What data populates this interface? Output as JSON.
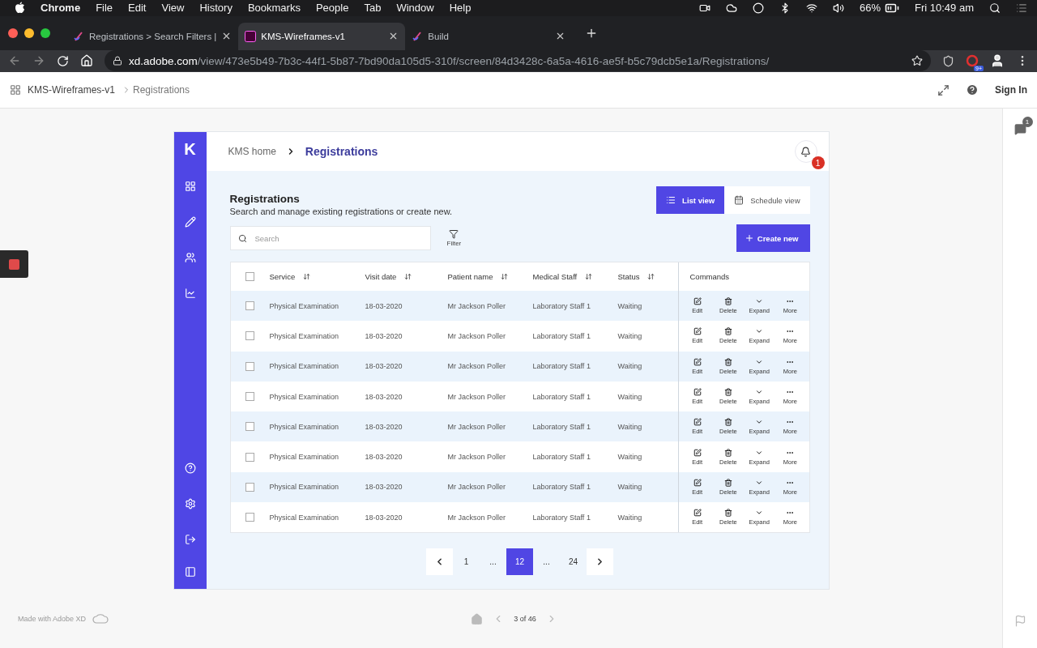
{
  "menubar": {
    "app": "Chrome",
    "items": [
      "File",
      "Edit",
      "View",
      "History",
      "Bookmarks",
      "People",
      "Tab",
      "Window",
      "Help"
    ],
    "battery": "66%",
    "clock": "Fri 10:49 am"
  },
  "browser": {
    "tabs": [
      {
        "title": "Registrations > Search Filters |",
        "kind": "build",
        "selected": false
      },
      {
        "title": "KMS-Wireframes-v1",
        "kind": "xd",
        "selected": true
      },
      {
        "title": "Build",
        "kind": "build",
        "selected": false
      }
    ],
    "url_host": "xd.adobe.com",
    "url_path": "/view/473e5b49-7b3c-44f1-5b87-7bd90da105d5-310f/screen/84d3428c-6a5a-4616-ae5f-b5c79dcb5e1a/Registrations/",
    "extension_badge": "9+"
  },
  "xd_bar": {
    "project": "KMS-Wireframes-v1",
    "screen": "Registrations",
    "sign_in": "Sign In",
    "comment_count": "1"
  },
  "app": {
    "logo": "K",
    "nav_top": [
      {
        "kind": "grid"
      },
      {
        "kind": "edit"
      },
      {
        "kind": "users"
      },
      {
        "kind": "chart"
      }
    ],
    "nav_bottom": [
      {
        "kind": "help"
      },
      {
        "kind": "settings"
      },
      {
        "kind": "logout"
      }
    ],
    "breadcrumb": {
      "home": "KMS home",
      "current": "Registrations"
    },
    "notification_count": "1",
    "title": "Registrations",
    "subtitle": "Search and manage existing registrations or create new.",
    "views": [
      {
        "label": "List view",
        "kind": "list",
        "selected": true
      },
      {
        "label": "Schedule view",
        "kind": "calendar",
        "selected": false
      }
    ],
    "search": {
      "placeholder": "Search"
    },
    "filter": "Filter",
    "create": "Create new",
    "table": {
      "select_all": false,
      "columns": [
        "Service",
        "Visit date",
        "Patient name",
        "Medical Staff",
        "Status"
      ],
      "commands_header": "Commands",
      "rows": [
        {
          "checked": false,
          "cells": [
            "Physical Examination",
            "18-03-2020",
            "Mr Jackson Poller",
            "Laboratory Staff 1",
            "Waiting"
          ],
          "commands": [
            {
              "kind": "edit",
              "label": "Edit"
            },
            {
              "kind": "delete",
              "label": "Delete"
            },
            {
              "kind": "expand",
              "label": "Expand"
            },
            {
              "kind": "more",
              "label": "More"
            }
          ]
        },
        {
          "checked": false,
          "cells": [
            "Physical Examination",
            "18-03-2020",
            "Mr Jackson Poller",
            "Laboratory Staff 1",
            "Waiting"
          ],
          "commands": [
            {
              "kind": "edit",
              "label": "Edit"
            },
            {
              "kind": "delete",
              "label": "Delete"
            },
            {
              "kind": "expand",
              "label": "Expand"
            },
            {
              "kind": "more",
              "label": "More"
            }
          ]
        },
        {
          "checked": false,
          "cells": [
            "Physical Examination",
            "18-03-2020",
            "Mr Jackson Poller",
            "Laboratory Staff 1",
            "Waiting"
          ],
          "commands": [
            {
              "kind": "edit",
              "label": "Edit"
            },
            {
              "kind": "delete",
              "label": "Delete"
            },
            {
              "kind": "expand",
              "label": "Expand"
            },
            {
              "kind": "more",
              "label": "More"
            }
          ]
        },
        {
          "checked": false,
          "cells": [
            "Physical Examination",
            "18-03-2020",
            "Mr Jackson Poller",
            "Laboratory Staff 1",
            "Waiting"
          ],
          "commands": [
            {
              "kind": "edit",
              "label": "Edit"
            },
            {
              "kind": "delete",
              "label": "Delete"
            },
            {
              "kind": "expand",
              "label": "Expand"
            },
            {
              "kind": "more",
              "label": "More"
            }
          ]
        },
        {
          "checked": false,
          "cells": [
            "Physical Examination",
            "18-03-2020",
            "Mr Jackson Poller",
            "Laboratory Staff 1",
            "Waiting"
          ],
          "commands": [
            {
              "kind": "edit",
              "label": "Edit"
            },
            {
              "kind": "delete",
              "label": "Delete"
            },
            {
              "kind": "expand",
              "label": "Expand"
            },
            {
              "kind": "more",
              "label": "More"
            }
          ]
        },
        {
          "checked": false,
          "cells": [
            "Physical Examination",
            "18-03-2020",
            "Mr Jackson Poller",
            "Laboratory Staff 1",
            "Waiting"
          ],
          "commands": [
            {
              "kind": "edit",
              "label": "Edit"
            },
            {
              "kind": "delete",
              "label": "Delete"
            },
            {
              "kind": "expand",
              "label": "Expand"
            },
            {
              "kind": "more",
              "label": "More"
            }
          ]
        },
        {
          "checked": false,
          "cells": [
            "Physical Examination",
            "18-03-2020",
            "Mr Jackson Poller",
            "Laboratory Staff 1",
            "Waiting"
          ],
          "commands": [
            {
              "kind": "edit",
              "label": "Edit"
            },
            {
              "kind": "delete",
              "label": "Delete"
            },
            {
              "kind": "expand",
              "label": "Expand"
            },
            {
              "kind": "more",
              "label": "More"
            }
          ]
        },
        {
          "checked": false,
          "cells": [
            "Physical Examination",
            "18-03-2020",
            "Mr Jackson Poller",
            "Laboratory Staff 1",
            "Waiting"
          ],
          "commands": [
            {
              "kind": "edit",
              "label": "Edit"
            },
            {
              "kind": "delete",
              "label": "Delete"
            },
            {
              "kind": "expand",
              "label": "Expand"
            },
            {
              "kind": "more",
              "label": "More"
            }
          ]
        }
      ]
    },
    "pagination": [
      {
        "kind": "page",
        "label": "1",
        "selected": false
      },
      {
        "kind": "ellipsis",
        "label": "..."
      },
      {
        "kind": "page",
        "label": "12",
        "selected": true
      },
      {
        "kind": "ellipsis",
        "label": "..."
      },
      {
        "kind": "page",
        "label": "24",
        "selected": false
      }
    ]
  },
  "footer": {
    "made_with": "Made with Adobe XD",
    "position": "3 of 46"
  }
}
